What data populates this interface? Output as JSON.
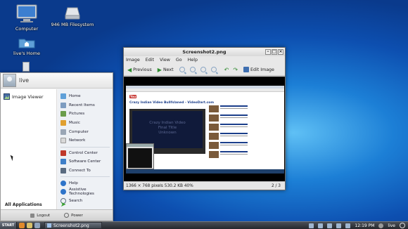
{
  "desktop": {
    "icons": [
      {
        "label": "Computer"
      },
      {
        "label": "946 MB Filesystem"
      },
      {
        "label": "live's Home"
      }
    ]
  },
  "start_menu": {
    "username": "live",
    "favorites": [
      {
        "label": "Image Viewer"
      }
    ],
    "places": [
      {
        "label": "Home",
        "icon": "home-icon"
      },
      {
        "label": "Recent Items",
        "icon": "recent-icon"
      },
      {
        "label": "Pictures",
        "icon": "pictures-icon"
      },
      {
        "label": "Music",
        "icon": "music-icon"
      },
      {
        "label": "Computer",
        "icon": "computer-icon"
      },
      {
        "label": "Network",
        "icon": "network-icon"
      }
    ],
    "system": [
      {
        "label": "Control Center",
        "icon": "control-center-icon"
      },
      {
        "label": "Software Center",
        "icon": "software-center-icon"
      },
      {
        "label": "Connect To",
        "icon": "connect-to-icon"
      }
    ],
    "help": [
      {
        "label": "Help",
        "icon": "help-icon"
      },
      {
        "label": "Assistive Technologies",
        "icon": "accessibility-icon"
      },
      {
        "label": "Search",
        "icon": "search-icon"
      }
    ],
    "all_applications": "All Applications",
    "logout": "Logout",
    "power": "Power"
  },
  "viewer": {
    "title": "Screenshot2.png",
    "menu": [
      "Image",
      "Edit",
      "View",
      "Go",
      "Help"
    ],
    "toolbar": {
      "previous": "Previous",
      "next": "Next",
      "edit_image": "Edit Image"
    },
    "status": {
      "info": "1366 × 768 pixels  530.2 KB   40%",
      "position": "2 / 3"
    },
    "screenshot_content": {
      "page_title": "Crazy Indian Video Bullfslaned - VideoDart.com",
      "player_text": "Crazy Indian Video\nFinal Title\nUnknown",
      "logo": "You"
    }
  },
  "taskbar": {
    "start_label": "START",
    "task": "Screenshot2.png",
    "clock": "12:19 PM",
    "user": "live"
  },
  "colors": {
    "accent": "#1c7fd6",
    "menu_bg": "#f3f3f3",
    "taskbar": "#2f3238"
  }
}
